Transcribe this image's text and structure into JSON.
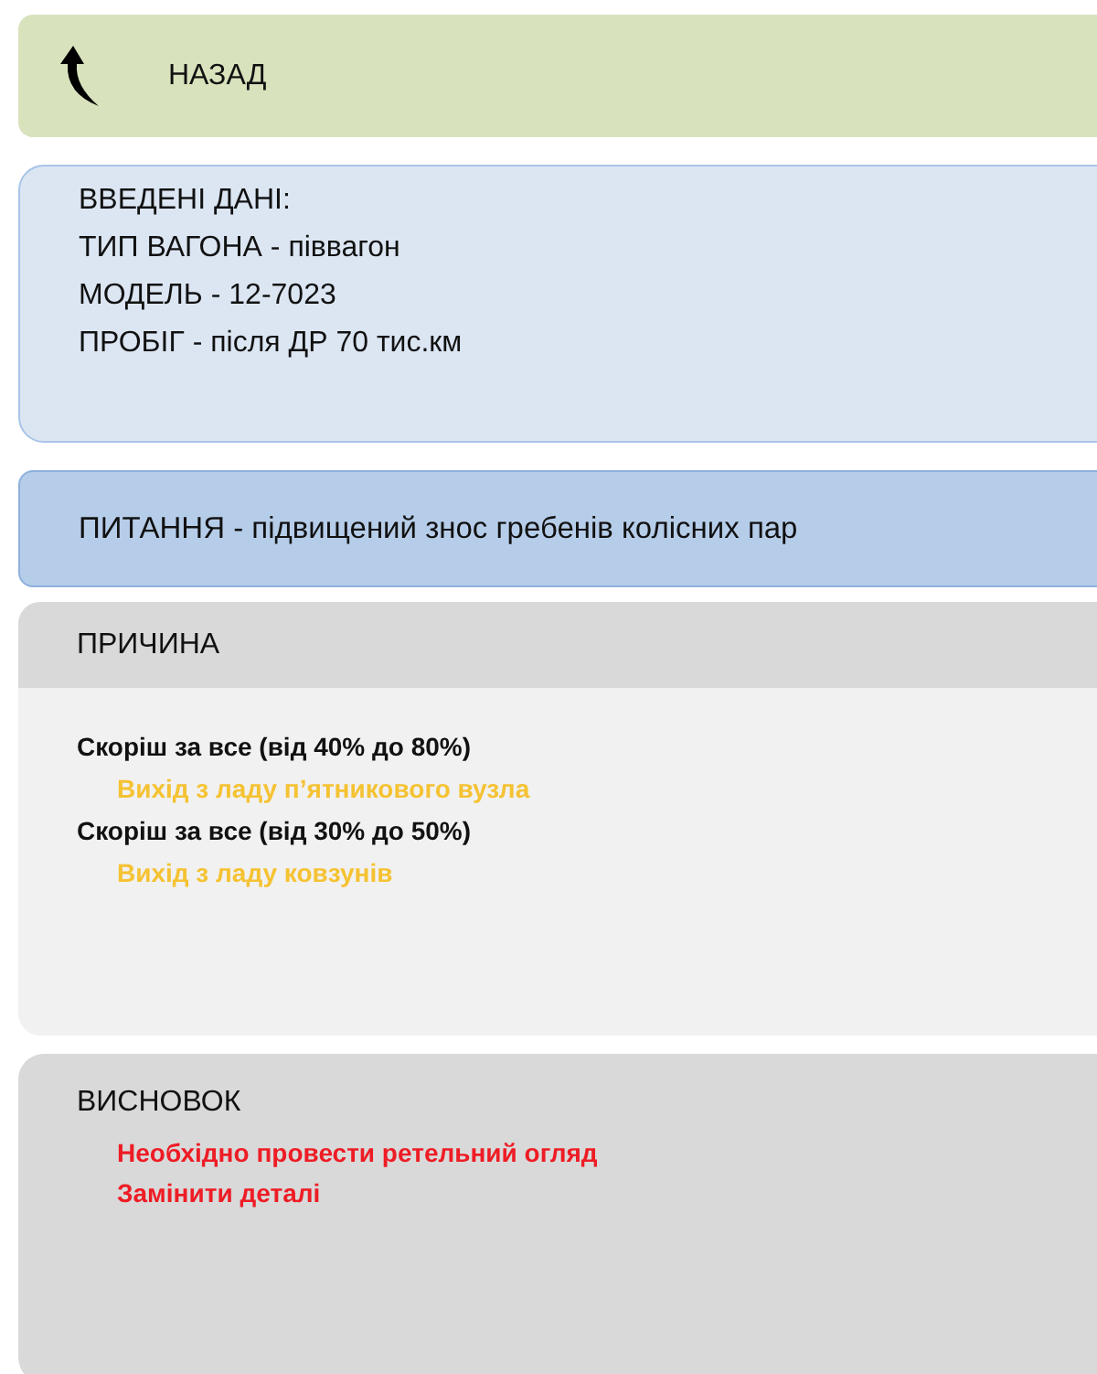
{
  "back_button": {
    "label": "НАЗАД"
  },
  "input_data": {
    "title": "ВВЕДЕНІ ДАНІ:",
    "lines": [
      "ТИП ВАГОНА - піввагон",
      "МОДЕЛЬ - 12-7023",
      "ПРОБІГ -  після ДР 70 тис.км"
    ]
  },
  "question": {
    "text": "ПИТАННЯ - підвищений знос гребенів колісних пар"
  },
  "cause": {
    "title": "ПРИЧИНА",
    "lines": [
      {
        "kind": "probability",
        "text": "Скоріш за все (від 40% до 80%)"
      },
      {
        "kind": "cause",
        "text": "Вихід з ладу п’ятникового вузла"
      },
      {
        "kind": "probability",
        "text": "Скоріш за все (від 30% до 50%)"
      },
      {
        "kind": "cause",
        "text": "Вихід з ладу ковзунів"
      }
    ]
  },
  "conclusion": {
    "title": "ВИСНОВОК",
    "lines": [
      "Необхідно провести ретельний огляд",
      "Замінити деталі"
    ]
  }
}
